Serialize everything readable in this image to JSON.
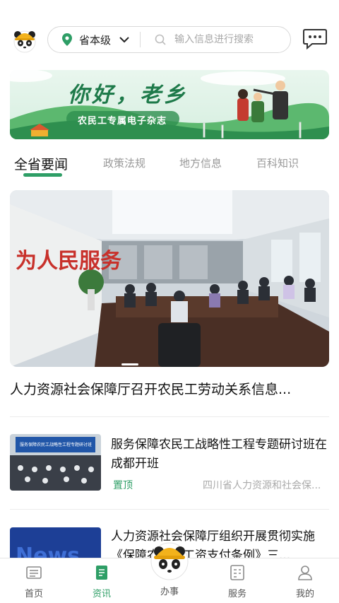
{
  "header": {
    "region_label": "省本级",
    "search_placeholder": "输入信息进行搜索",
    "icons": [
      "panda-avatar-icon",
      "location-pin-icon",
      "chevron-down-icon",
      "search-icon",
      "message-icon"
    ]
  },
  "banner": {
    "title": "你好，老乡",
    "subtitle": "农民工专属电子杂志"
  },
  "tabs": [
    {
      "label": "全省要闻",
      "active": true
    },
    {
      "label": "政策法规",
      "active": false
    },
    {
      "label": "地方信息",
      "active": false
    },
    {
      "label": "百科知识",
      "active": false
    }
  ],
  "feature": {
    "title": "人力资源社会保障厅召开农民工劳动关系信息...",
    "image_text": "为人民服务"
  },
  "news": [
    {
      "title": "服务保障农民工战略性工程专题研讨班在成都开班",
      "tag": "置顶",
      "source": "四川省人力资源和社会保...",
      "thumb_text": "服务保障农民工战略性工程专题研讨班"
    },
    {
      "title": "人力资源社会保障厅组织开展贯彻实施《保障农民工工资支付条例》三...",
      "thumb_text": "News"
    }
  ],
  "bottom_nav": [
    {
      "label": "首页",
      "icon": "home-icon",
      "active": false
    },
    {
      "label": "资讯",
      "icon": "news-icon",
      "active": true
    },
    {
      "label": "办事",
      "icon": "panda-hardhat-icon",
      "active": false
    },
    {
      "label": "服务",
      "icon": "service-icon",
      "active": false
    },
    {
      "label": "我的",
      "icon": "profile-icon",
      "active": false
    }
  ],
  "colors": {
    "accent": "#2e9e66",
    "muted_text": "#999999"
  }
}
